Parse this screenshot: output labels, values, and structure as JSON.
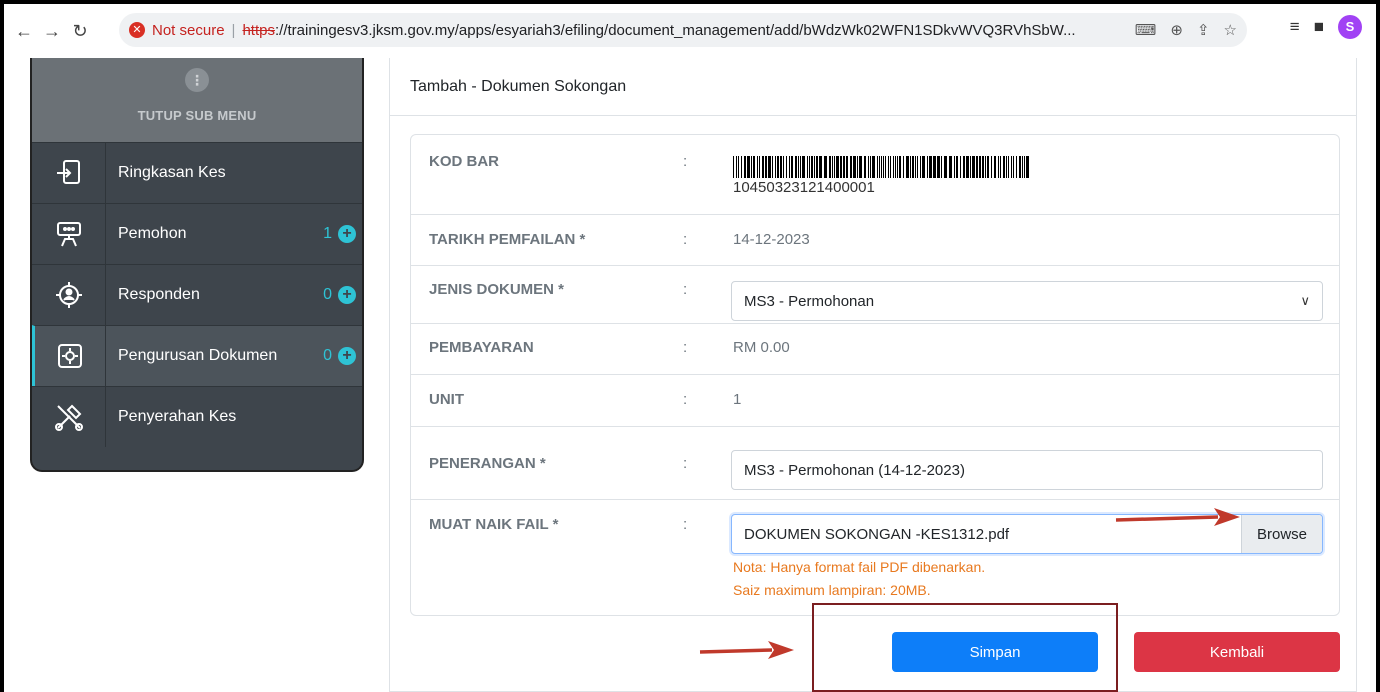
{
  "browser": {
    "security_label": "Not secure",
    "url_scheme": "https",
    "url_rest": "://trainingesv3.jksm.gov.my/apps/esyariah3/efiling/document_management/add/bWdzWk02WFN1SDkvWVQ3RVhSbW...",
    "profile_initial": "S"
  },
  "sidebar": {
    "toggle_label": "TUTUP SUB MENU",
    "items": [
      {
        "label": "Ringkasan Kes",
        "count": ""
      },
      {
        "label": "Pemohon",
        "count": "1"
      },
      {
        "label": "Responden",
        "count": "0"
      },
      {
        "label": "Pengurusan Dokumen",
        "count": "0"
      },
      {
        "label": "Penyerahan Kes",
        "count": ""
      }
    ]
  },
  "panel": {
    "title": "Tambah - Dokumen Sokongan"
  },
  "form": {
    "barcode_label": "KOD BAR",
    "barcode_value": "10450323121400001",
    "filing_date_label": "TARIKH PEMFAILAN *",
    "filing_date_value": "14-12-2023",
    "doc_type_label": "JENIS DOKUMEN *",
    "doc_type_value": "MS3 - Permohonan",
    "payment_label": "PEMBAYARAN",
    "payment_value": "RM 0.00",
    "unit_label": "UNIT",
    "unit_value": "1",
    "description_label": "PENERANGAN *",
    "description_value": "MS3 - Permohonan (14-12-2023)",
    "upload_label": "MUAT NAIK FAIL *",
    "upload_value": "DOKUMEN SOKONGAN -KES1312.pdf",
    "browse_label": "Browse",
    "note_format": "Nota: Hanya format fail PDF dibenarkan.",
    "note_size": "Saiz maximum lampiran: 20MB.",
    "colon": ":"
  },
  "actions": {
    "save_label": "Simpan",
    "back_label": "Kembali"
  },
  "colors": {
    "accent": "#2ec3d5",
    "primary": "#0d7ef9",
    "danger": "#dc3545",
    "annotation": "#c0392b"
  }
}
